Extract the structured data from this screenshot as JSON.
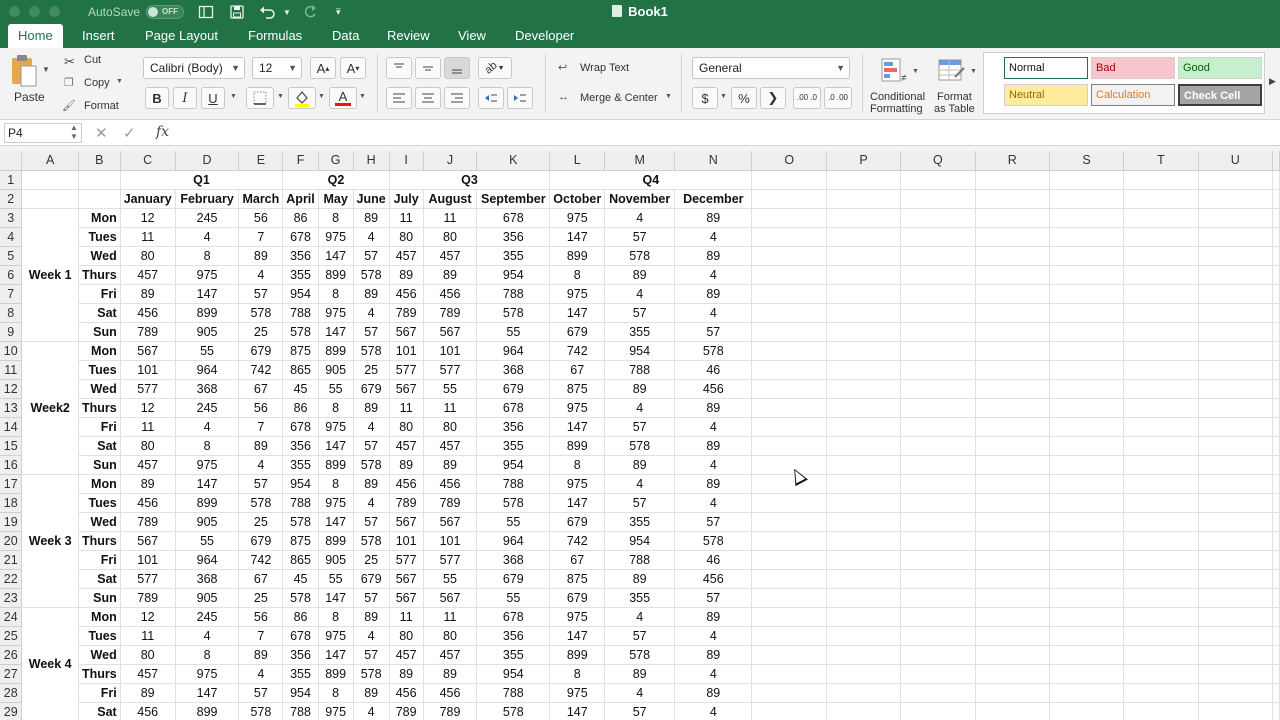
{
  "window": {
    "title": "Book1",
    "autosave_label": "AutoSave",
    "autosave_state": "OFF"
  },
  "tabs": [
    "Home",
    "Insert",
    "Page Layout",
    "Formulas",
    "Data",
    "Review",
    "View",
    "Developer"
  ],
  "ribbon": {
    "paste": "Paste",
    "cut": "Cut",
    "copy": "Copy",
    "format": "Format",
    "font_name": "Calibri (Body)",
    "font_size": "12",
    "bold": "B",
    "italic": "I",
    "underline": "U",
    "wrap_text": "Wrap Text",
    "merge_center": "Merge & Center",
    "number_format": "General",
    "currency": "$",
    "percent": "%",
    "comma": "❯",
    "increase_decimal": ".00 .0",
    "decrease_decimal": ".0 .00",
    "conditional_formatting_1": "Conditional",
    "conditional_formatting_2": "Formatting",
    "format_as_table_1": "Format",
    "format_as_table_2": "as Table",
    "styles": {
      "normal": "Normal",
      "bad": "Bad",
      "good": "Good",
      "neutral": "Neutral",
      "calculation": "Calculation",
      "check_cell": "Check Cell"
    }
  },
  "formula_bar": {
    "name_box": "P4",
    "fx": "fx",
    "value": ""
  },
  "grid": {
    "columns": [
      "A",
      "B",
      "C",
      "D",
      "E",
      "F",
      "G",
      "H",
      "I",
      "J",
      "K",
      "L",
      "M",
      "N",
      "O",
      "P",
      "Q",
      "R",
      "S",
      "T",
      "U"
    ],
    "quarters": [
      "Q1",
      "Q2",
      "Q3",
      "Q4"
    ],
    "months": [
      "January",
      "February",
      "March",
      "April",
      "May",
      "June",
      "July",
      "August",
      "September",
      "October",
      "November",
      "December"
    ],
    "weeks": [
      "Week 1",
      "Week2",
      "Week 3",
      "Week 4"
    ],
    "rows": [
      {
        "n": "3",
        "day": "Mon",
        "v": [
          "12",
          "245",
          "56",
          "86",
          "8",
          "89",
          "11",
          "11",
          "678",
          "975",
          "4",
          "89"
        ]
      },
      {
        "n": "4",
        "day": "Tues",
        "v": [
          "11",
          "4",
          "7",
          "678",
          "975",
          "4",
          "80",
          "80",
          "356",
          "147",
          "57",
          "4"
        ]
      },
      {
        "n": "5",
        "day": "Wed",
        "v": [
          "80",
          "8",
          "89",
          "356",
          "147",
          "57",
          "457",
          "457",
          "355",
          "899",
          "578",
          "89"
        ]
      },
      {
        "n": "6",
        "day": "Thurs",
        "v": [
          "457",
          "975",
          "4",
          "355",
          "899",
          "578",
          "89",
          "89",
          "954",
          "8",
          "89",
          "4"
        ]
      },
      {
        "n": "7",
        "day": "Fri",
        "v": [
          "89",
          "147",
          "57",
          "954",
          "8",
          "89",
          "456",
          "456",
          "788",
          "975",
          "4",
          "89"
        ]
      },
      {
        "n": "8",
        "day": "Sat",
        "v": [
          "456",
          "899",
          "578",
          "788",
          "975",
          "4",
          "789",
          "789",
          "578",
          "147",
          "57",
          "4"
        ]
      },
      {
        "n": "9",
        "day": "Sun",
        "v": [
          "789",
          "905",
          "25",
          "578",
          "147",
          "57",
          "567",
          "567",
          "55",
          "679",
          "355",
          "57"
        ]
      },
      {
        "n": "10",
        "day": "Mon",
        "v": [
          "567",
          "55",
          "679",
          "875",
          "899",
          "578",
          "101",
          "101",
          "964",
          "742",
          "954",
          "578"
        ]
      },
      {
        "n": "11",
        "day": "Tues",
        "v": [
          "101",
          "964",
          "742",
          "865",
          "905",
          "25",
          "577",
          "577",
          "368",
          "67",
          "788",
          "46"
        ]
      },
      {
        "n": "12",
        "day": "Wed",
        "v": [
          "577",
          "368",
          "67",
          "45",
          "55",
          "679",
          "567",
          "55",
          "679",
          "875",
          "89",
          "456"
        ]
      },
      {
        "n": "13",
        "day": "Thurs",
        "v": [
          "12",
          "245",
          "56",
          "86",
          "8",
          "89",
          "11",
          "11",
          "678",
          "975",
          "4",
          "89"
        ]
      },
      {
        "n": "14",
        "day": "Fri",
        "v": [
          "11",
          "4",
          "7",
          "678",
          "975",
          "4",
          "80",
          "80",
          "356",
          "147",
          "57",
          "4"
        ]
      },
      {
        "n": "15",
        "day": "Sat",
        "v": [
          "80",
          "8",
          "89",
          "356",
          "147",
          "57",
          "457",
          "457",
          "355",
          "899",
          "578",
          "89"
        ]
      },
      {
        "n": "16",
        "day": "Sun",
        "v": [
          "457",
          "975",
          "4",
          "355",
          "899",
          "578",
          "89",
          "89",
          "954",
          "8",
          "89",
          "4"
        ]
      },
      {
        "n": "17",
        "day": "Mon",
        "v": [
          "89",
          "147",
          "57",
          "954",
          "8",
          "89",
          "456",
          "456",
          "788",
          "975",
          "4",
          "89"
        ]
      },
      {
        "n": "18",
        "day": "Tues",
        "v": [
          "456",
          "899",
          "578",
          "788",
          "975",
          "4",
          "789",
          "789",
          "578",
          "147",
          "57",
          "4"
        ]
      },
      {
        "n": "19",
        "day": "Wed",
        "v": [
          "789",
          "905",
          "25",
          "578",
          "147",
          "57",
          "567",
          "567",
          "55",
          "679",
          "355",
          "57"
        ]
      },
      {
        "n": "20",
        "day": "Thurs",
        "v": [
          "567",
          "55",
          "679",
          "875",
          "899",
          "578",
          "101",
          "101",
          "964",
          "742",
          "954",
          "578"
        ]
      },
      {
        "n": "21",
        "day": "Fri",
        "v": [
          "101",
          "964",
          "742",
          "865",
          "905",
          "25",
          "577",
          "577",
          "368",
          "67",
          "788",
          "46"
        ]
      },
      {
        "n": "22",
        "day": "Sat",
        "v": [
          "577",
          "368",
          "67",
          "45",
          "55",
          "679",
          "567",
          "55",
          "679",
          "875",
          "89",
          "456"
        ]
      },
      {
        "n": "23",
        "day": "Sun",
        "v": [
          "789",
          "905",
          "25",
          "578",
          "147",
          "57",
          "567",
          "567",
          "55",
          "679",
          "355",
          "57"
        ]
      },
      {
        "n": "24",
        "day": "Mon",
        "v": [
          "12",
          "245",
          "56",
          "86",
          "8",
          "89",
          "11",
          "11",
          "678",
          "975",
          "4",
          "89"
        ]
      },
      {
        "n": "25",
        "day": "Tues",
        "v": [
          "11",
          "4",
          "7",
          "678",
          "975",
          "4",
          "80",
          "80",
          "356",
          "147",
          "57",
          "4"
        ]
      },
      {
        "n": "26",
        "day": "Wed",
        "v": [
          "80",
          "8",
          "89",
          "356",
          "147",
          "57",
          "457",
          "457",
          "355",
          "899",
          "578",
          "89"
        ]
      },
      {
        "n": "27",
        "day": "Thurs",
        "v": [
          "457",
          "975",
          "4",
          "355",
          "899",
          "578",
          "89",
          "89",
          "954",
          "8",
          "89",
          "4"
        ]
      },
      {
        "n": "28",
        "day": "Fri",
        "v": [
          "89",
          "147",
          "57",
          "954",
          "8",
          "89",
          "456",
          "456",
          "788",
          "975",
          "4",
          "89"
        ]
      },
      {
        "n": "29",
        "day": "Sat",
        "v": [
          "456",
          "899",
          "578",
          "788",
          "975",
          "4",
          "789",
          "789",
          "578",
          "147",
          "57",
          "4"
        ]
      }
    ]
  },
  "colors": {
    "accent": "#217346",
    "bad_bg": "#f8c7cd",
    "good_bg": "#c6efce",
    "neutral_bg": "#ffeb9c",
    "calc_text": "#e0752c"
  }
}
